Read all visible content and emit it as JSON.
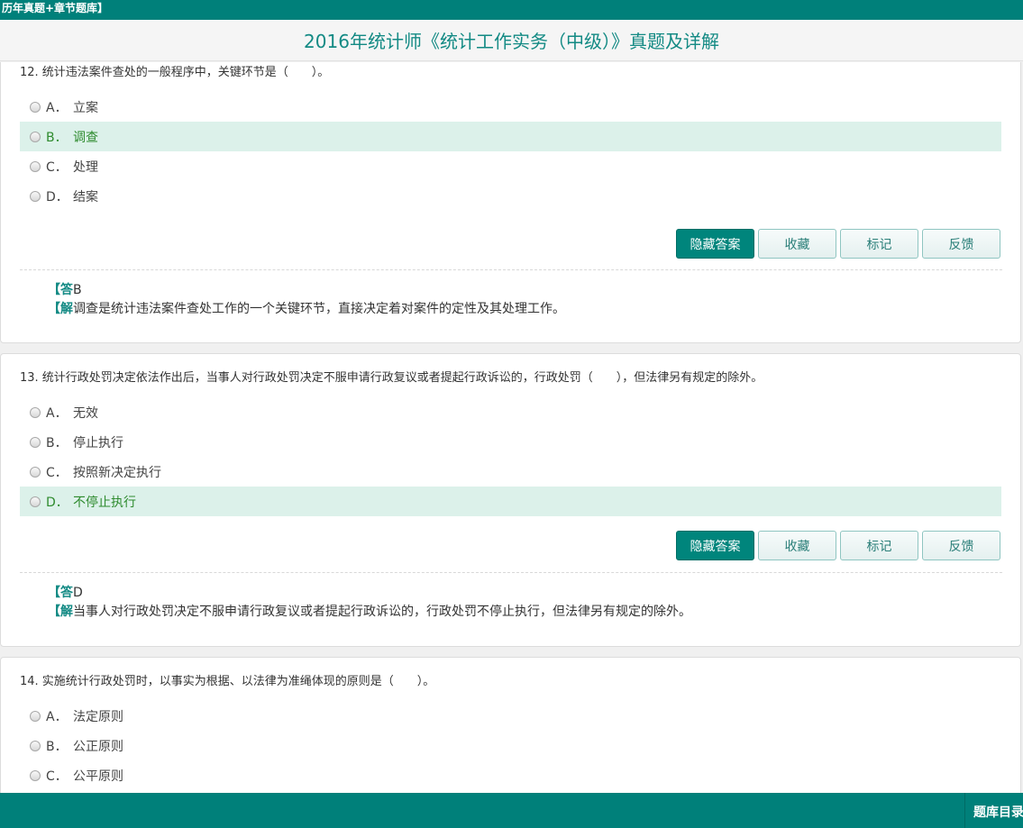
{
  "header": {
    "top_label": "历年真题+章节题库】",
    "title": "2016年统计师《统计工作实务（中级）》真题及详解"
  },
  "buttons": {
    "hide_answer": "隐藏答案",
    "favorite": "收藏",
    "mark": "标记",
    "feedback": "反馈"
  },
  "labels": {
    "answer_prefix": "【答",
    "explain_prefix": "【解"
  },
  "questions": [
    {
      "text": "12. 统计违法案件查处的一般程序中，关键环节是（　　）。",
      "options": [
        {
          "letter": "A．",
          "text": "立案"
        },
        {
          "letter": "B．",
          "text": "调查"
        },
        {
          "letter": "C．",
          "text": "处理"
        },
        {
          "letter": "D．",
          "text": "结案"
        }
      ],
      "selected": "B",
      "answer": "B",
      "explanation": "调查是统计违法案件查处工作的一个关键环节，直接决定着对案件的定性及其处理工作。"
    },
    {
      "text": "13. 统计行政处罚决定依法作出后，当事人对行政处罚决定不服申请行政复议或者提起行政诉讼的，行政处罚（　　），但法律另有规定的除外。",
      "options": [
        {
          "letter": "A．",
          "text": "无效"
        },
        {
          "letter": "B．",
          "text": "停止执行"
        },
        {
          "letter": "C．",
          "text": "按照新决定执行"
        },
        {
          "letter": "D．",
          "text": "不停止执行"
        }
      ],
      "selected": "D",
      "answer": "D",
      "explanation": "当事人对行政处罚决定不服申请行政复议或者提起行政诉讼的，行政处罚不停止执行，但法律另有规定的除外。"
    },
    {
      "text": "14. 实施统计行政处罚时，以事实为根据、以法律为准绳体现的原则是（　　）。",
      "options": [
        {
          "letter": "A．",
          "text": "法定原则"
        },
        {
          "letter": "B．",
          "text": "公正原则"
        },
        {
          "letter": "C．",
          "text": "公平原则"
        }
      ]
    }
  ],
  "footer": {
    "catalog_label": "题库目录"
  },
  "colors": {
    "brand": "#00807a",
    "title_text": "#138a84",
    "selected_bg": "#dcf1ea",
    "selected_text": "#2e8b2e"
  }
}
